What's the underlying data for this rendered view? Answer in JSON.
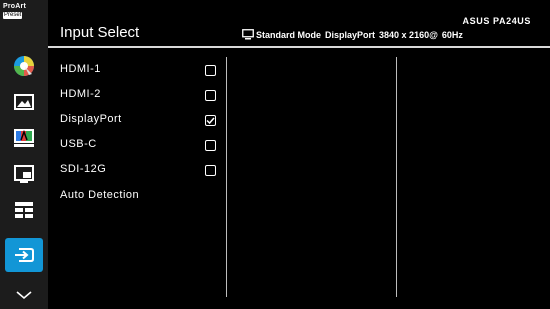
{
  "rail": {
    "logo_line1": "ProArt",
    "logo_line2": "Preset"
  },
  "header": {
    "title": "Input Select",
    "model": "ASUS PA24US",
    "status": {
      "mode": "Standard Mode",
      "input": "DisplayPort",
      "resolution": "3840 x 2160@",
      "refresh": "60Hz"
    }
  },
  "inputs": [
    {
      "label": "HDMI-1",
      "checked": false
    },
    {
      "label": "HDMI-2",
      "checked": false
    },
    {
      "label": "DisplayPort",
      "checked": true
    },
    {
      "label": "USB-C",
      "checked": false
    },
    {
      "label": "SDI-12G",
      "checked": false
    },
    {
      "label": "Auto Detection",
      "checked": null
    }
  ],
  "colors": {
    "accent": "#1296d6",
    "background": "#000000",
    "rail": "#1c1c1c"
  }
}
